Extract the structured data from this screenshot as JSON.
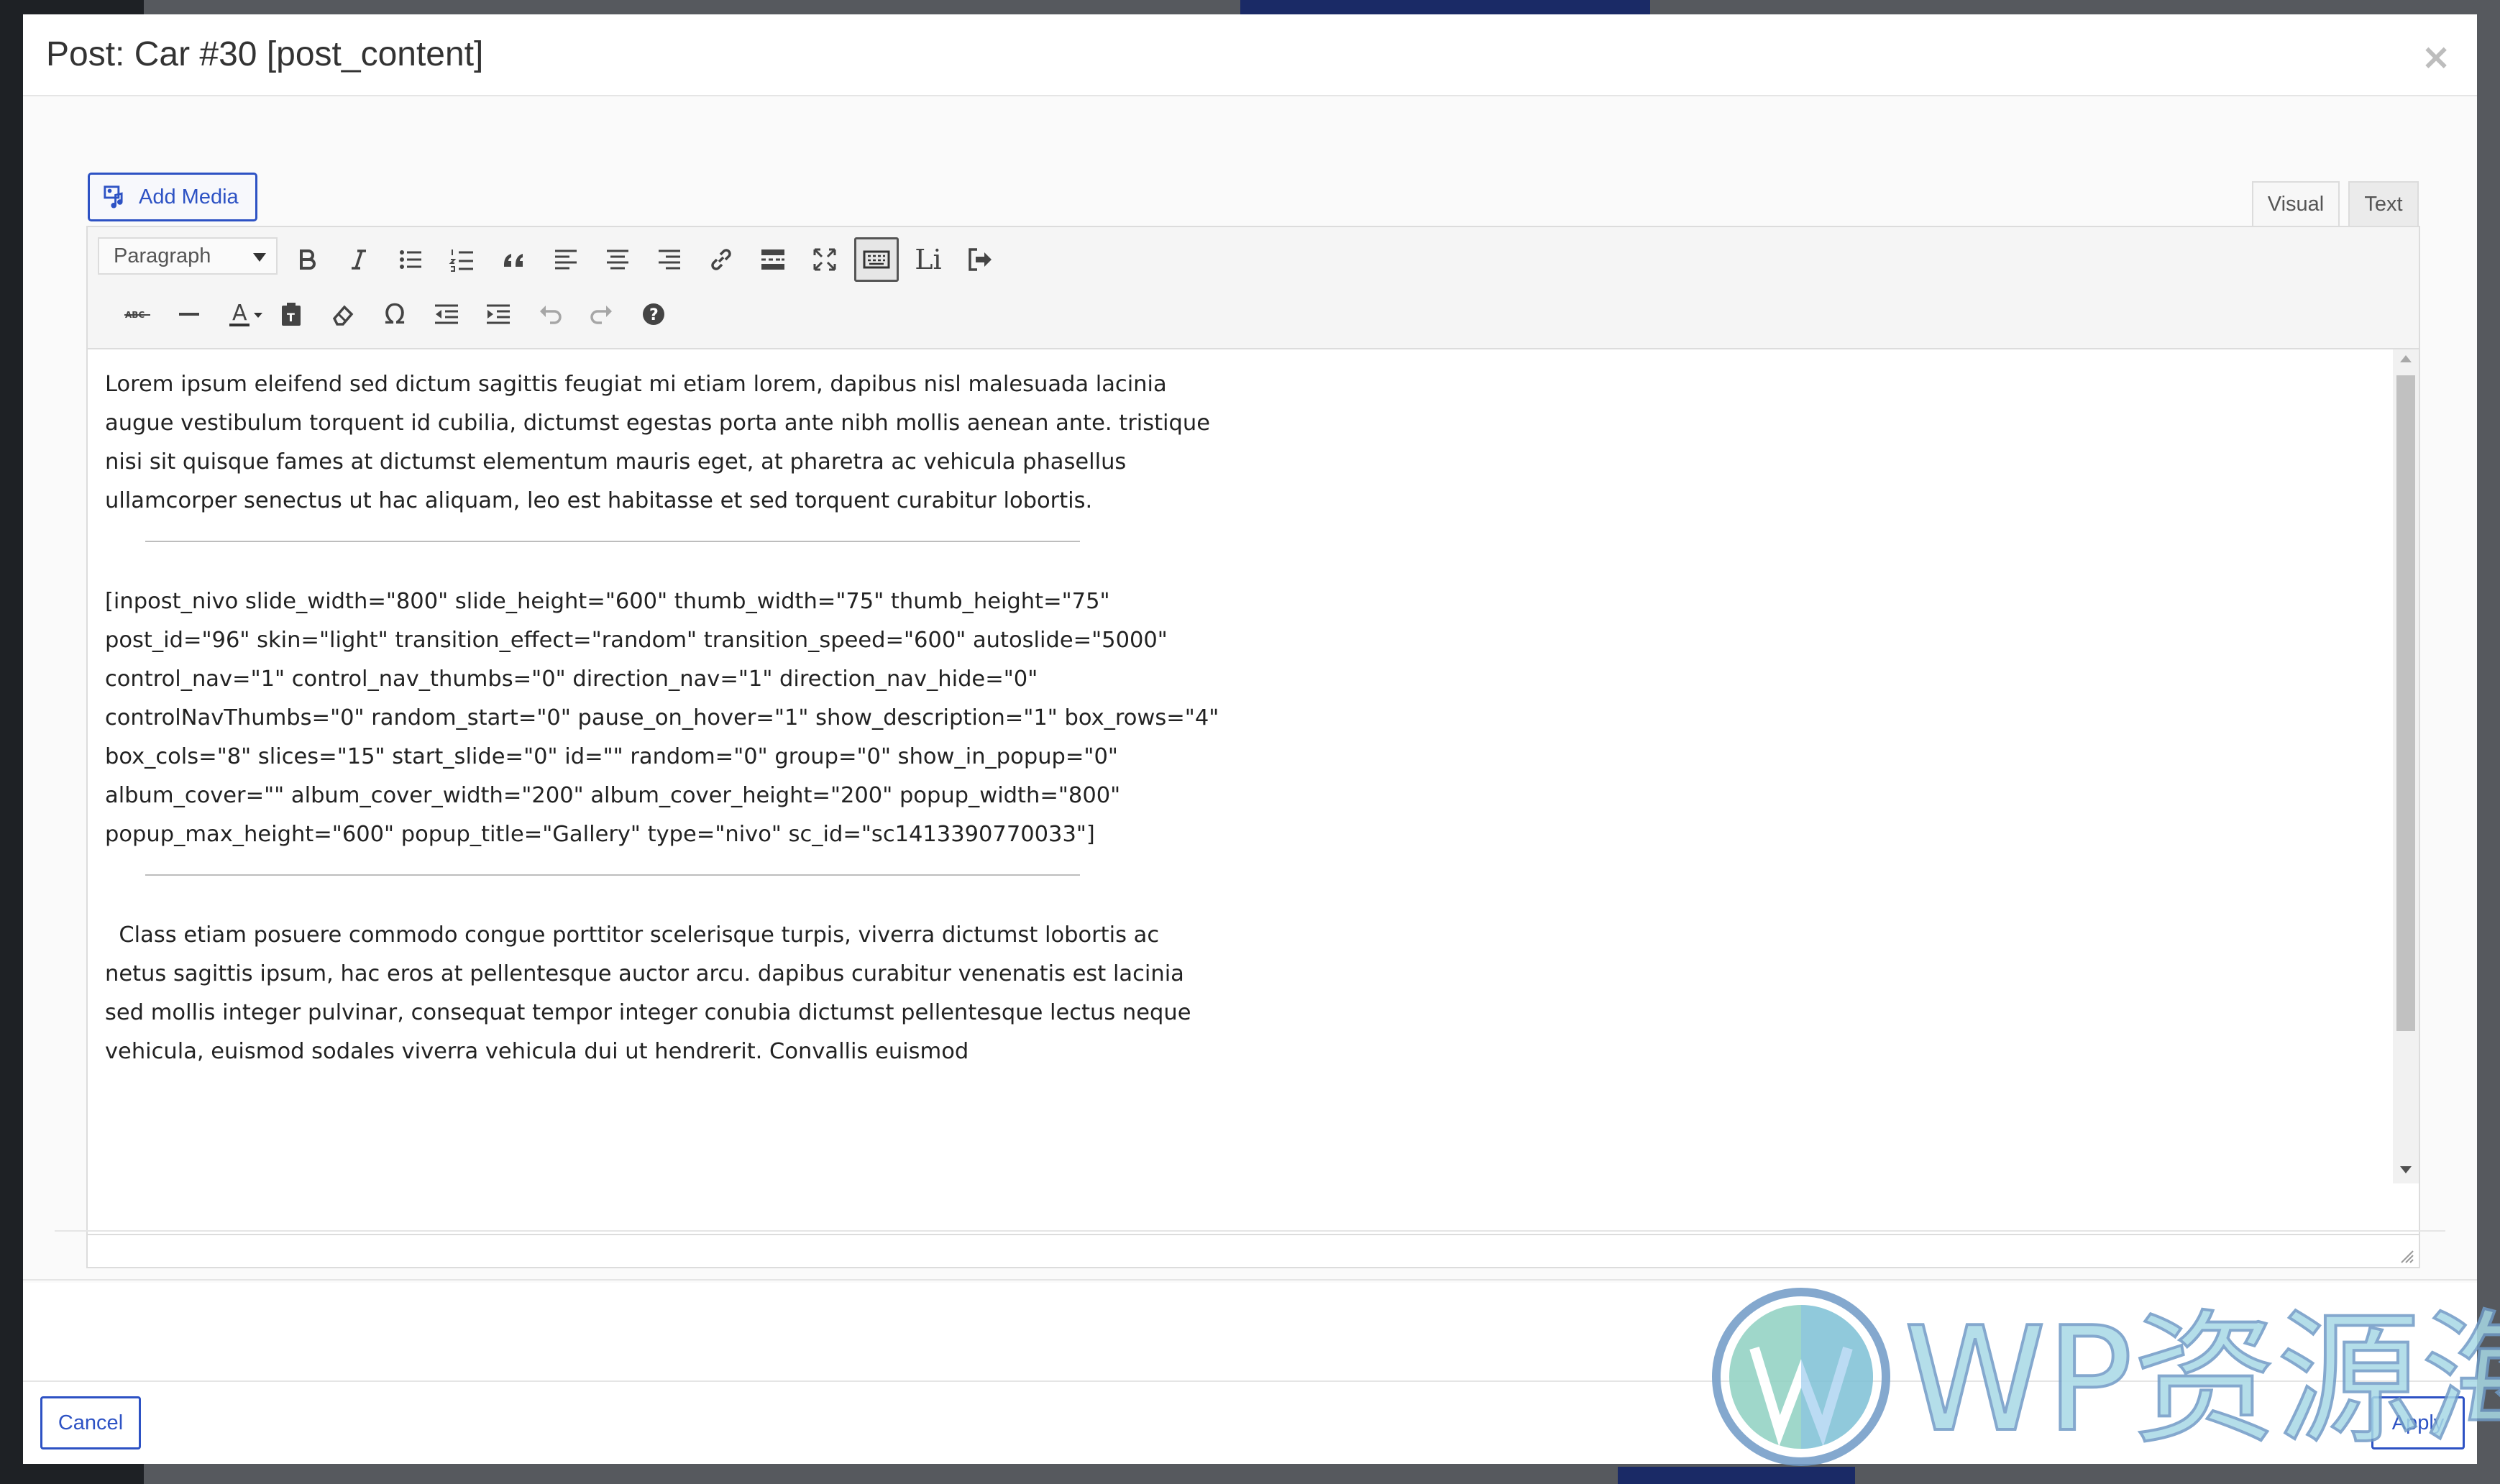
{
  "modal": {
    "title": "Post: Car #30 [post_content]",
    "close_glyph": "×"
  },
  "add_media_label": "Add Media",
  "tabs": {
    "visual": "Visual",
    "text": "Text"
  },
  "toolbar": {
    "format_value": "Paragraph",
    "row1_icons": [
      "bold-icon",
      "italic-icon",
      "bullet-list-icon",
      "numbered-list-icon",
      "blockquote-icon",
      "align-left-icon",
      "align-center-icon",
      "align-right-icon",
      "link-icon",
      "read-more-icon",
      "fullscreen-icon",
      "toolbar-toggle-icon",
      "li-button",
      "exit-icon"
    ],
    "row2_icons": [
      "strikethrough-icon",
      "horizontal-line-icon",
      "text-color-icon",
      "paste-text-icon",
      "clear-formatting-icon",
      "special-character-icon",
      "outdent-icon",
      "indent-icon",
      "undo-icon",
      "redo-icon",
      "help-icon"
    ],
    "li_label": "Li",
    "text_color_letter": "A",
    "strike_label": "ABC",
    "omega": "Ω"
  },
  "content": {
    "paragraph1": "Lorem ipsum eleifend sed dictum sagittis feugiat mi etiam lorem, dapibus nisl malesuada lacinia augue vestibulum torquent id cubilia, dictumst egestas porta ante nibh mollis aenean ante. tristique nisi sit quisque fames at dictumst elementum mauris eget, at pharetra ac vehicula phasellus ullamcorper senectus ut hac aliquam, leo est habitasse et sed torquent curabitur lobortis.",
    "shortcode": "[inpost_nivo slide_width=\"800\" slide_height=\"600\" thumb_width=\"75\" thumb_height=\"75\" post_id=\"96\" skin=\"light\" transition_effect=\"random\" transition_speed=\"600\" autoslide=\"5000\" control_nav=\"1\" control_nav_thumbs=\"0\" direction_nav=\"1\" direction_nav_hide=\"0\" controlNavThumbs=\"0\" random_start=\"0\" pause_on_hover=\"1\" show_description=\"1\" box_rows=\"4\" box_cols=\"8\" slices=\"15\" start_slide=\"0\" id=\"\" random=\"0\" group=\"0\" show_in_popup=\"0\" album_cover=\"\" album_cover_width=\"200\" album_cover_height=\"200\" popup_width=\"800\" popup_max_height=\"600\" popup_title=\"Gallery\" type=\"nivo\" sc_id=\"sc1413390770033\"]",
    "paragraph2": "  Class etiam posuere commodo congue porttitor scelerisque turpis, viverra dictumst lobortis ac netus sagittis ipsum, hac eros at pellentesque auctor arcu. dapibus curabitur venenatis est lacinia sed mollis integer pulvinar, consequat tempor integer conubia dictumst pellentesque lectus neque vehicula, euismod sodales viverra vehicula dui ut hendrerit. Convallis euismod"
  },
  "footer": {
    "cancel_label": "Cancel",
    "apply_label": "Apply"
  },
  "watermark": {
    "text": "WP资源海"
  },
  "colors": {
    "accent": "#2d52c4",
    "overlay": "#56595e"
  }
}
